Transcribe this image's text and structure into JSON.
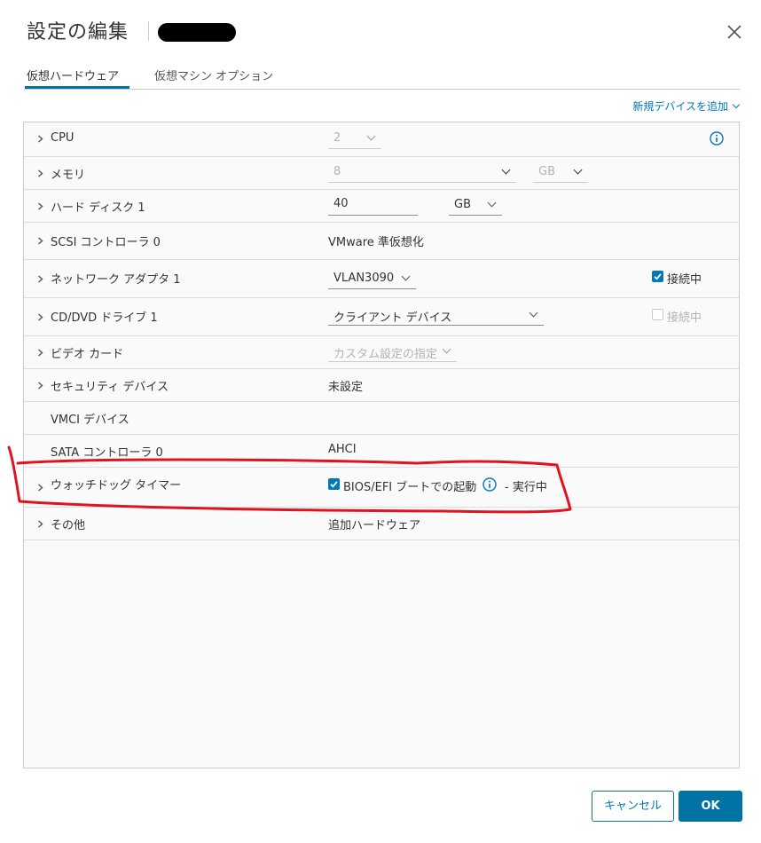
{
  "dialog": {
    "title": "設定の編集",
    "tabs": [
      {
        "label": "仮想ハードウェア",
        "active": true
      },
      {
        "label": "仮想マシン オプション",
        "active": false
      }
    ],
    "add_device_label": "新規デバイスを追加"
  },
  "rows": {
    "cpu": {
      "label": "CPU",
      "value": "2"
    },
    "memory": {
      "label": "メモリ",
      "value": "8",
      "unit": "GB"
    },
    "hard_disk": {
      "label": "ハード ディスク 1",
      "value": "40",
      "unit": "GB"
    },
    "scsi": {
      "label": "SCSI コントローラ 0",
      "value": "VMware 準仮想化"
    },
    "network": {
      "label": "ネットワーク アダプタ 1",
      "value": "VLAN3090",
      "connected_label": "接続中",
      "connected": true
    },
    "cddvd": {
      "label": "CD/DVD ドライブ 1",
      "value": "クライアント デバイス",
      "connected_label": "接続中",
      "connected": false
    },
    "video": {
      "label": "ビデオ カード",
      "value": "カスタム設定の指定"
    },
    "security": {
      "label": "セキュリティ デバイス",
      "value": "未設定"
    },
    "vmci": {
      "label": "VMCI デバイス"
    },
    "sata": {
      "label": "SATA コントローラ 0",
      "value": "AHCI"
    },
    "watchdog": {
      "label": "ウォッチドッグ タイマー",
      "checkbox_label": "BIOS/EFI ブートでの起動",
      "checked": true,
      "status": "- 実行中"
    },
    "other": {
      "label": "その他",
      "value": "追加ハードウェア"
    }
  },
  "buttons": {
    "cancel": "キャンセル",
    "ok": "OK"
  },
  "colors": {
    "accent": "#0079b8",
    "primary_button": "#0072a3",
    "annotation": "#e0141e"
  }
}
